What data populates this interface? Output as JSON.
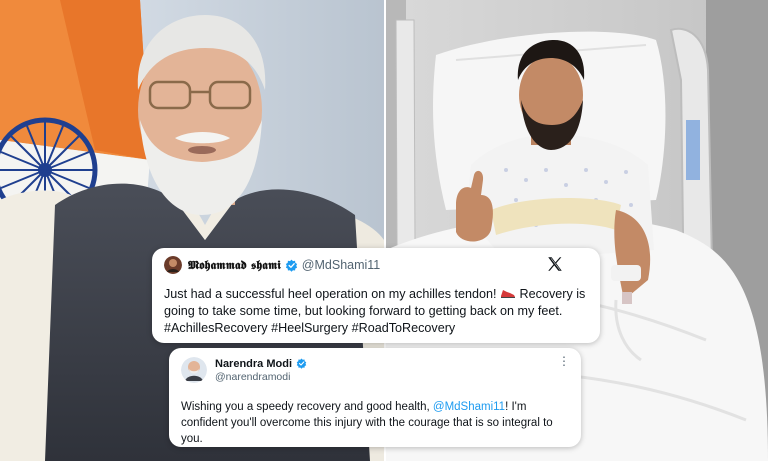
{
  "tweet1": {
    "display_name": "𝕸𝖔𝖍𝖆𝖒𝖒𝖆𝖉 𝖘𝖍𝖆𝖒𝖎",
    "handle": "@MdShami11",
    "text_1": "Just had a successful heel operation on my achilles tendon! ",
    "text_2": " Recovery is going to take some time, but looking forward to getting back on my feet.",
    "hashtags": "#AchillesRecovery #HeelSurgery #RoadToRecovery",
    "logo_icon": "x-logo-icon",
    "verified_icon": "verified-badge-icon"
  },
  "tweet2": {
    "display_name": "Narendra Modi",
    "handle": "@narendramodi",
    "text_1": "Wishing you a speedy recovery and good health, ",
    "mention": "@MdShami11",
    "text_2": "! I'm confident you'll overcome this injury with the courage that is so integral to you.",
    "more_icon": "more-options-icon"
  },
  "colors": {
    "verified": "#1d9bf0",
    "mention": "#1d9bf0",
    "text": "#0f1419",
    "muted": "#536471"
  }
}
